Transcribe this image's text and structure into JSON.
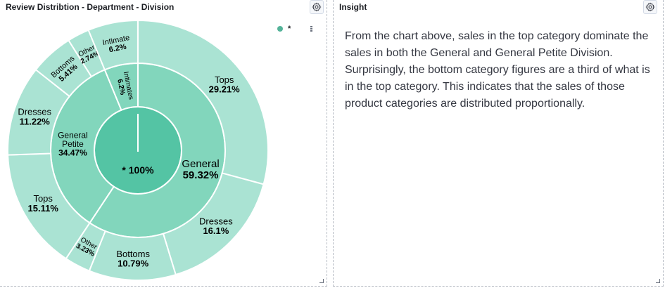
{
  "left_panel": {
    "title": "Review Distribtion - Department - Division",
    "legend": {
      "label": "*"
    }
  },
  "right_panel": {
    "title": "Insight",
    "text": "From the chart above, sales in the top category dominate the sales in both the General and General Petite Division. Surprisingly, the bottom category figures are a third of what is in the top category. This indicates that the sales of those product categories are distributed proportionally."
  },
  "chart_data": {
    "type": "pie",
    "subtype": "sunburst",
    "colors": {
      "center": "#54c4a4",
      "middle": "#82d6bc",
      "outer": "#aae3d3",
      "stroke": "#ffffff"
    },
    "center": {
      "name": "*",
      "value": 100,
      "label": "* 100%"
    },
    "divisions": [
      {
        "name": "General",
        "value": 59.32,
        "children": [
          {
            "name": "Tops",
            "value": 29.21
          },
          {
            "name": "Dresses",
            "value": 16.1
          },
          {
            "name": "Bottoms",
            "value": 10.79
          },
          {
            "name": "Other",
            "value": 3.23
          }
        ]
      },
      {
        "name": "General Petite",
        "value": 34.47,
        "children": [
          {
            "name": "Tops",
            "value": 15.11
          },
          {
            "name": "Dresses",
            "value": 11.22
          },
          {
            "name": "Bottoms",
            "value": 5.41
          },
          {
            "name": "Other",
            "value": 2.74
          }
        ]
      },
      {
        "name": "Intimates",
        "value": 6.2,
        "children": [
          {
            "name": "Intimate",
            "value": 6.2
          }
        ]
      }
    ]
  }
}
